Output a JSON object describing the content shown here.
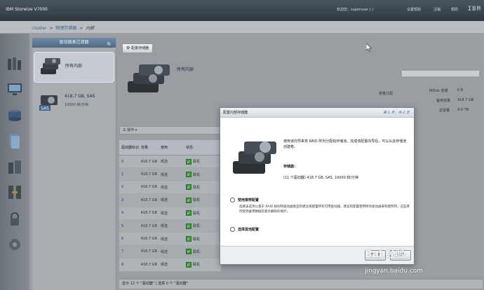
{
  "topbar": {
    "product": "IBM Storwize V7000",
    "welcome": "欢迎您，superuser ( )",
    "links": [
      "设置帮助",
      "注销",
      "帮助"
    ],
    "logo": "IBM"
  },
  "breadcrumb": {
    "items": [
      "cluster",
      "物理存储器",
      "内部"
    ],
    "separator": ">"
  },
  "nav": {
    "icons": [
      "home-icon",
      "monitoring-icon",
      "pools-icon",
      "volumes-icon",
      "hosts-icon",
      "copy-services-icon",
      "access-icon",
      "settings-icon"
    ]
  },
  "filter": {
    "header": "驱动器类过滤器",
    "items": [
      {
        "title": "所有内部",
        "subtitle": ""
      },
      {
        "title": "418.7 GB, SAS",
        "subtitle": "10000 转/分钟"
      }
    ]
  },
  "main": {
    "config_button": "配置存储器",
    "hero_title": "所有内部",
    "capacity_label": "容量分配",
    "mdisk_label": "MDisk 容量",
    "mdisk_value": "0 B",
    "spare_label": "备用容量",
    "spare_value": "418.7 GB",
    "total_label": "总容量",
    "total_value": "4.9 TB",
    "actions_label": "操作",
    "table": {
      "headers": [
        "驱动器标识",
        "容量",
        "使用",
        "状态"
      ],
      "rows": [
        {
          "id": "0",
          "cap": "418.7 GB",
          "use": "候选",
          "status": "联机"
        },
        {
          "id": "1",
          "cap": "418.7 GB",
          "use": "候选",
          "status": "联机"
        },
        {
          "id": "2",
          "cap": "418.7 GB",
          "use": "候选",
          "status": "联机"
        },
        {
          "id": "3",
          "cap": "418.7 GB",
          "use": "候选",
          "status": "联机"
        },
        {
          "id": "4",
          "cap": "418.7 GB",
          "use": "候选",
          "status": "联机"
        },
        {
          "id": "5",
          "cap": "418.7 GB",
          "use": "候选",
          "status": "联机"
        },
        {
          "id": "6",
          "cap": "418.7 GB",
          "use": "候选",
          "status": "联机"
        },
        {
          "id": "7",
          "cap": "418.7 GB",
          "use": "候选",
          "status": "联机"
        },
        {
          "id": "8",
          "cap": "418.7 GB",
          "use": "候选",
          "status": "联机"
        }
      ]
    },
    "status_text": "显示 12 个 “驱动器” | 选择 0 个 “驱动器”"
  },
  "dialog": {
    "title": "配置内部存储器",
    "step": "第 1 步，共 2 步",
    "description": "使用该向导来将 RAID 阵列分配给存储池。完成该配置向导后，可以从此存储池创建卷。",
    "storage_label": "存储器：",
    "storage_value": "(11 个驱动器) 418.7 GB, SAS, 10000 转/分钟",
    "option1_label": "使用推荐配置",
    "option1_desc": "选择该选项以基于 RAID 级别和驱动器类型的建议值配置所有可用驱动器。建议的配置使用所有驱动器来构建阵列，这些阵列受到备用数据的意外删除的保护。",
    "option2_label": "选择其他配置",
    "next_button": "下一步",
    "cancel_button": "取消"
  },
  "watermark": {
    "main": "Bai 经验",
    "sub": "jingyan.baidu.com"
  }
}
